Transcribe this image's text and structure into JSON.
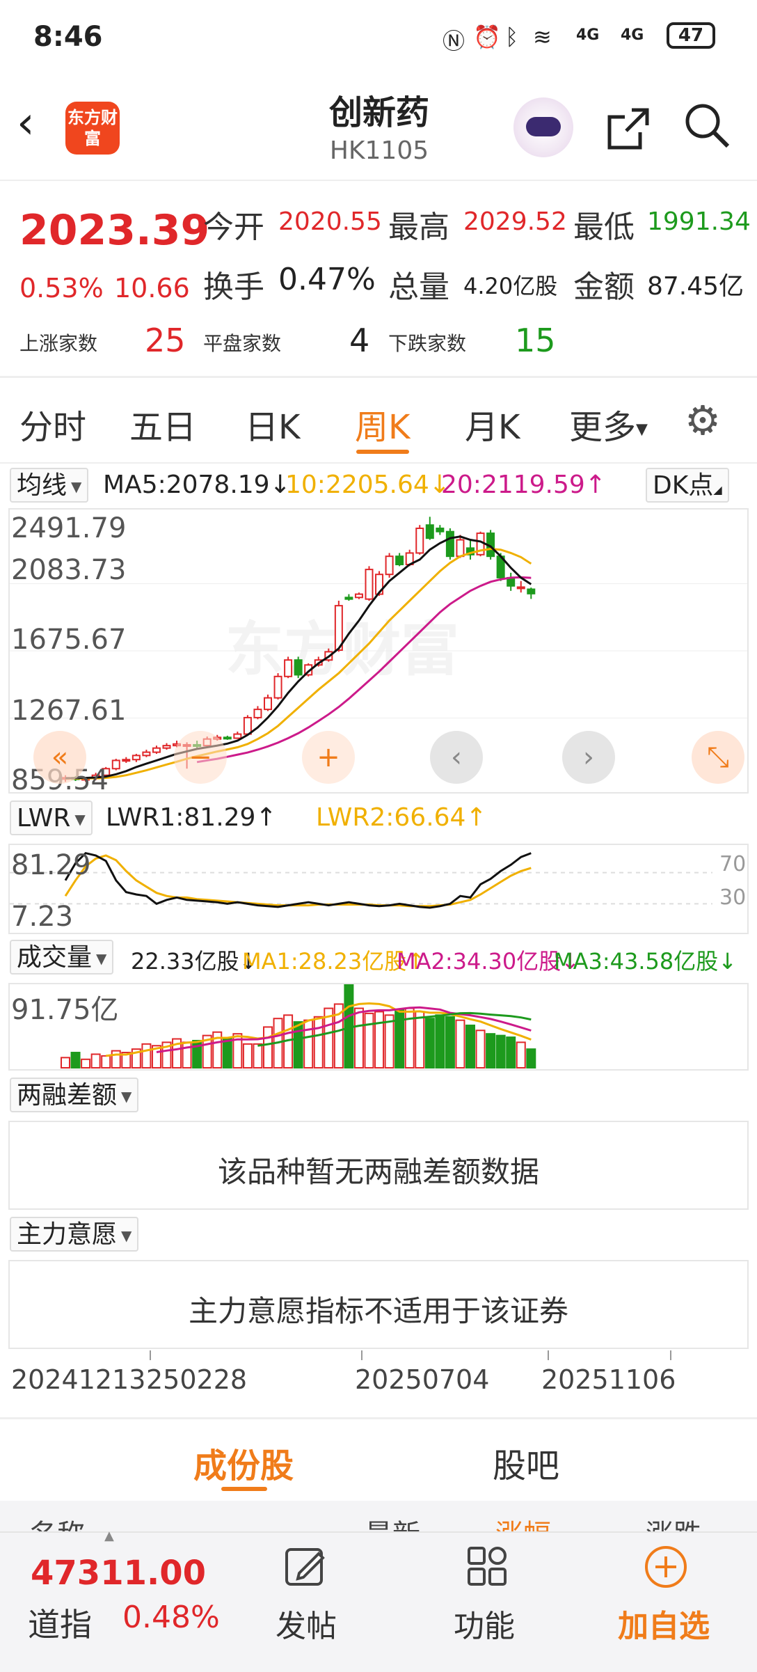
{
  "status": {
    "time": "8:46",
    "battery": "47",
    "network": "4G",
    "network2": "4G"
  },
  "header": {
    "title": "创新药",
    "code": "HK1105",
    "logo_text": "东方财富"
  },
  "quote": {
    "price": "2023.39",
    "pct": "0.53%",
    "change": "10.66",
    "open_label": "今开",
    "open": "2020.55",
    "high_label": "最高",
    "high": "2029.52",
    "low_label": "最低",
    "low": "1991.34",
    "turnover_label": "换手",
    "turnover": "0.47%",
    "volume_label": "总量",
    "volume": "4.20亿股",
    "amount_label": "金额",
    "amount": "87.45亿",
    "up_label": "上涨家数",
    "up": "25",
    "flat_label": "平盘家数",
    "flat": "4",
    "down_label": "下跌家数",
    "down": "15"
  },
  "tabs": [
    "分时",
    "五日",
    "日K",
    "周K",
    "月K",
    "更多"
  ],
  "ma": {
    "selector": "均线",
    "ma5": "MA5:2078.19↓",
    "ma10": "10:2205.64↓",
    "ma20": "20:2119.59↑",
    "dk": "DK点"
  },
  "kline": {
    "y_labels": [
      "2491.79",
      "2083.73",
      "1675.67",
      "1267.61",
      "859.54"
    ],
    "watermark": "东方财富"
  },
  "lwr": {
    "selector": "LWR",
    "lwr1": "LWR1:81.29↑",
    "lwr2": "LWR2:66.64↑",
    "y_labels": [
      "81.29",
      "7.23"
    ],
    "right_labels": [
      "70",
      "30"
    ]
  },
  "vol": {
    "selector": "成交量",
    "value": "22.33亿股↓",
    "ma1": "MA1:28.23亿股↑",
    "ma2": "MA2:34.30亿股↓",
    "ma3": "MA3:43.58亿股↓",
    "y_label": "91.75亿"
  },
  "margin": {
    "selector": "两融差额",
    "message": "该品种暂无两融差额数据"
  },
  "main_force": {
    "selector": "主力意愿",
    "message": "主力意愿指标不适用于该证券"
  },
  "x_dates": [
    "20241213",
    "250228",
    "20250704",
    "20251106"
  ],
  "subtabs": {
    "components": "成份股",
    "forum": "股吧"
  },
  "list_header": {
    "name": "名称",
    "latest": "最新",
    "change_pct": "涨幅",
    "change": "涨跌"
  },
  "bottom": {
    "index_value": "47311.00",
    "index_name": "道指",
    "index_pct": "0.48%",
    "post": "发帖",
    "function": "功能",
    "add": "加自选"
  },
  "colors": {
    "up": "#e0272a",
    "down": "#1d9a1d",
    "accent": "#f07c1a",
    "ma5": "#111111",
    "ma10": "#f0b000",
    "ma20": "#cc1a8a"
  },
  "chart_data": {
    "type": "candlestick",
    "ylim": [
      859.54,
      2491.79
    ],
    "candles": [
      {
        "o": 900,
        "c": 905,
        "h": 920,
        "l": 880
      },
      {
        "o": 905,
        "c": 895,
        "h": 915,
        "l": 885
      },
      {
        "o": 895,
        "c": 900,
        "h": 910,
        "l": 880
      },
      {
        "o": 900,
        "c": 920,
        "h": 935,
        "l": 890
      },
      {
        "o": 920,
        "c": 960,
        "h": 970,
        "l": 910
      },
      {
        "o": 960,
        "c": 1010,
        "h": 1020,
        "l": 950
      },
      {
        "o": 1010,
        "c": 1015,
        "h": 1030,
        "l": 995
      },
      {
        "o": 1015,
        "c": 1040,
        "h": 1050,
        "l": 1000
      },
      {
        "o": 1040,
        "c": 1060,
        "h": 1075,
        "l": 1030
      },
      {
        "o": 1060,
        "c": 1085,
        "h": 1100,
        "l": 1050
      },
      {
        "o": 1085,
        "c": 1100,
        "h": 1115,
        "l": 1075
      },
      {
        "o": 1100,
        "c": 1110,
        "h": 1130,
        "l": 1090
      },
      {
        "o": 1100,
        "c": 1105,
        "h": 1120,
        "l": 960
      },
      {
        "o": 1105,
        "c": 1100,
        "h": 1130,
        "l": 1080
      },
      {
        "o": 1100,
        "c": 1140,
        "h": 1155,
        "l": 1090
      },
      {
        "o": 1140,
        "c": 1150,
        "h": 1165,
        "l": 1130
      },
      {
        "o": 1150,
        "c": 1145,
        "h": 1160,
        "l": 1135
      },
      {
        "o": 1145,
        "c": 1170,
        "h": 1185,
        "l": 1140
      },
      {
        "o": 1170,
        "c": 1270,
        "h": 1285,
        "l": 1160
      },
      {
        "o": 1270,
        "c": 1320,
        "h": 1340,
        "l": 1260
      },
      {
        "o": 1320,
        "c": 1390,
        "h": 1410,
        "l": 1310
      },
      {
        "o": 1390,
        "c": 1520,
        "h": 1540,
        "l": 1380
      },
      {
        "o": 1520,
        "c": 1620,
        "h": 1640,
        "l": 1510
      },
      {
        "o": 1620,
        "c": 1530,
        "h": 1640,
        "l": 1510
      },
      {
        "o": 1530,
        "c": 1590,
        "h": 1600,
        "l": 1520
      },
      {
        "o": 1590,
        "c": 1620,
        "h": 1640,
        "l": 1580
      },
      {
        "o": 1620,
        "c": 1670,
        "h": 1690,
        "l": 1610
      },
      {
        "o": 1680,
        "c": 1950,
        "h": 1980,
        "l": 1670
      },
      {
        "o": 2000,
        "c": 1990,
        "h": 2020,
        "l": 1980
      },
      {
        "o": 2000,
        "c": 2020,
        "h": 2030,
        "l": 1990
      },
      {
        "o": 1990,
        "c": 2170,
        "h": 2190,
        "l": 1980
      },
      {
        "o": 2020,
        "c": 2140,
        "h": 2160,
        "l": 2010
      },
      {
        "o": 2140,
        "c": 2250,
        "h": 2270,
        "l": 2120
      },
      {
        "o": 2250,
        "c": 2200,
        "h": 2270,
        "l": 2190
      },
      {
        "o": 2200,
        "c": 2270,
        "h": 2290,
        "l": 2190
      },
      {
        "o": 2270,
        "c": 2420,
        "h": 2440,
        "l": 2260
      },
      {
        "o": 2440,
        "c": 2360,
        "h": 2490,
        "l": 2350
      },
      {
        "o": 2420,
        "c": 2400,
        "h": 2440,
        "l": 2380
      },
      {
        "o": 2400,
        "c": 2250,
        "h": 2420,
        "l": 2230
      },
      {
        "o": 2250,
        "c": 2350,
        "h": 2380,
        "l": 2240
      },
      {
        "o": 2300,
        "c": 2260,
        "h": 2350,
        "l": 2230
      },
      {
        "o": 2260,
        "c": 2390,
        "h": 2400,
        "l": 2250
      },
      {
        "o": 2390,
        "c": 2250,
        "h": 2410,
        "l": 2230
      },
      {
        "o": 2250,
        "c": 2120,
        "h": 2270,
        "l": 2100
      },
      {
        "o": 2120,
        "c": 2070,
        "h": 2150,
        "l": 2040
      },
      {
        "o": 2060,
        "c": 2063,
        "h": 2100,
        "l": 2030
      },
      {
        "o": 2050,
        "c": 2023,
        "h": 2060,
        "l": 1991
      }
    ],
    "ma5": [
      902,
      903,
      904,
      906,
      912,
      926,
      945,
      970,
      990,
      1010,
      1030,
      1050,
      1065,
      1080,
      1090,
      1100,
      1112,
      1130,
      1165,
      1210,
      1270,
      1340,
      1420,
      1490,
      1550,
      1600,
      1640,
      1690,
      1780,
      1860,
      1950,
      2030,
      2100,
      2150,
      2200,
      2230,
      2290,
      2330,
      2360,
      2370,
      2350,
      2340,
      2310,
      2250,
      2180,
      2120,
      2080
    ],
    "ma10": [
      900,
      900,
      901,
      902,
      904,
      910,
      920,
      935,
      950,
      968,
      985,
      1002,
      1020,
      1036,
      1050,
      1064,
      1077,
      1090,
      1110,
      1140,
      1175,
      1220,
      1275,
      1330,
      1385,
      1440,
      1490,
      1540,
      1600,
      1660,
      1720,
      1790,
      1860,
      1920,
      1980,
      2040,
      2100,
      2160,
      2210,
      2250,
      2270,
      2285,
      2295,
      2290,
      2270,
      2245,
      2205
    ],
    "ma20": [
      null,
      null,
      null,
      null,
      null,
      null,
      null,
      null,
      null,
      null,
      null,
      null,
      null,
      1000,
      1010,
      1020,
      1032,
      1045,
      1058,
      1075,
      1095,
      1118,
      1145,
      1175,
      1210,
      1250,
      1290,
      1335,
      1385,
      1440,
      1495,
      1550,
      1610,
      1670,
      1730,
      1790,
      1850,
      1910,
      1960,
      2000,
      2040,
      2070,
      2095,
      2110,
      2120,
      2122,
      2119
    ],
    "volume": [
      12,
      18,
      10,
      16,
      14,
      20,
      18,
      22,
      28,
      26,
      30,
      34,
      30,
      32,
      38,
      42,
      34,
      40,
      28,
      28,
      48,
      58,
      62,
      54,
      56,
      60,
      70,
      75,
      100,
      70,
      64,
      66,
      62,
      68,
      70,
      66,
      58,
      62,
      60,
      56,
      50,
      44,
      40,
      38,
      36,
      30,
      22
    ],
    "volume_ylim": [
      0,
      91.75
    ],
    "lwr1": [
      60,
      82,
      95,
      92,
      85,
      60,
      45,
      42,
      40,
      30,
      35,
      38,
      35,
      34,
      33,
      32,
      30,
      32,
      30,
      28,
      27,
      26,
      28,
      30,
      32,
      30,
      28,
      30,
      32,
      30,
      28,
      27,
      28,
      30,
      28,
      26,
      25,
      27,
      30,
      40,
      38,
      55,
      62,
      72,
      80,
      90,
      95
    ],
    "lwr2": [
      40,
      60,
      78,
      88,
      92,
      86,
      72,
      60,
      52,
      44,
      40,
      38,
      38,
      36,
      35,
      34,
      33,
      32,
      31,
      30,
      29,
      28,
      28,
      28,
      28,
      29,
      29,
      29,
      29,
      29,
      29,
      28,
      28,
      28,
      27,
      27,
      27,
      28,
      29,
      32,
      35,
      42,
      50,
      58,
      66,
      72,
      76
    ],
    "lwr_ylim": [
      0,
      100
    ]
  }
}
